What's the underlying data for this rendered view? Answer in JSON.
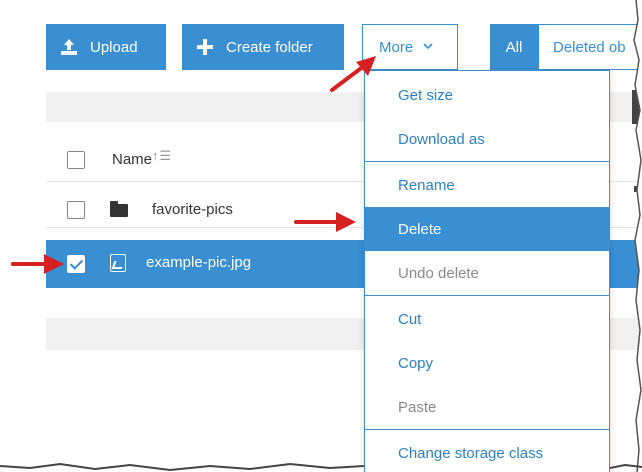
{
  "toolbar": {
    "upload_label": "Upload",
    "create_folder_label": "Create folder",
    "more_label": "More",
    "filter_all_label": "All",
    "filter_deleted_label": "Deleted ob"
  },
  "table": {
    "header_name": "Name",
    "rows": [
      {
        "name": "favorite-pics",
        "type": "folder",
        "checked": false
      },
      {
        "name": "example-pic.jpg",
        "type": "image",
        "checked": true
      }
    ]
  },
  "menu": {
    "items": [
      {
        "label": "Get size",
        "state": "normal"
      },
      {
        "label": "Download as",
        "state": "normal"
      },
      {
        "label": "Rename",
        "state": "normal"
      },
      {
        "label": "Delete",
        "state": "active"
      },
      {
        "label": "Undo delete",
        "state": "disabled"
      },
      {
        "label": "Cut",
        "state": "normal"
      },
      {
        "label": "Copy",
        "state": "normal"
      },
      {
        "label": "Paste",
        "state": "disabled"
      },
      {
        "label": "Change storage class",
        "state": "normal"
      }
    ]
  },
  "colors": {
    "accent": "#3a8ed2",
    "menu_text": "#2d7fc1",
    "disabled_text": "#8a8a8a",
    "annotation_arrow": "#d42222",
    "band": "#f0f0f0"
  },
  "icons": [
    "upload-icon",
    "plus-icon",
    "chevron-down-icon",
    "sort-ascending-icon",
    "folder-icon",
    "image-file-icon"
  ]
}
